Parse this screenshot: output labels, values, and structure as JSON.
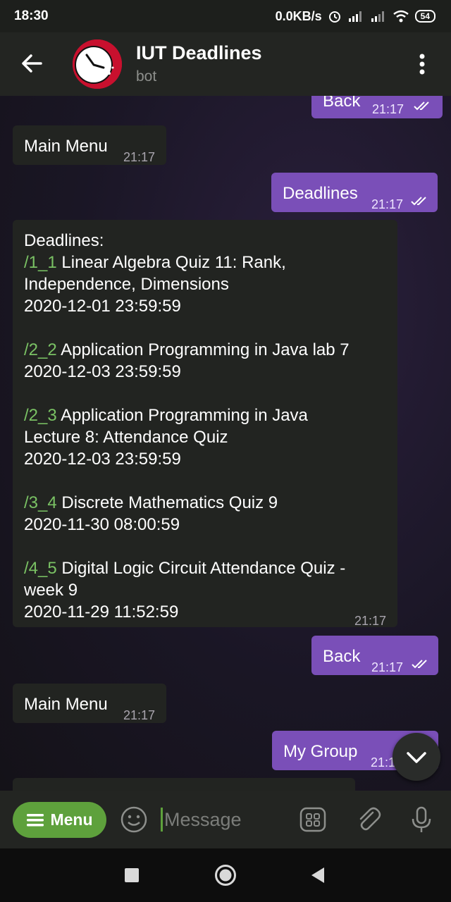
{
  "status_bar": {
    "time": "18:30",
    "net_speed": "0.0KB/s",
    "battery": "54",
    "icons": [
      "alarm-icon",
      "signal-icon",
      "signal-icon",
      "wifi-icon",
      "battery-icon"
    ]
  },
  "header": {
    "title": "IUT Deadlines",
    "subtitle": "bot"
  },
  "messages": {
    "m0": {
      "text": "Back",
      "time": "21:17"
    },
    "m1": {
      "text": "Main Menu",
      "time": "21:17"
    },
    "m2": {
      "text": "Deadlines",
      "time": "21:17"
    },
    "m3": {
      "heading": "Deadlines:",
      "items": [
        {
          "cmd": "/1_1",
          "line1": " Linear Algebra Quiz 11: Rank,",
          "line2": "Independence, Dimensions",
          "date": "2020-12-01 23:59:59"
        },
        {
          "cmd": "/2_2",
          "line1": " Application Programming in Java lab 7",
          "line2": "",
          "date": "2020-12-03 23:59:59"
        },
        {
          "cmd": "/2_3",
          "line1": " Application Programming in Java",
          "line2": "Lecture 8: Attendance Quiz",
          "date": "2020-12-03 23:59:59"
        },
        {
          "cmd": "/3_4",
          "line1": " Discrete Mathematics Quiz 9",
          "line2": "",
          "date": "2020-11-30 08:00:59"
        },
        {
          "cmd": "/4_5",
          "line1": " Digital Logic Circuit Attendance Quiz -",
          "line2": "week 9",
          "date": "2020-11-29 11:52:59"
        }
      ],
      "time": "21:17"
    },
    "m4": {
      "text": "Back",
      "time": "21:17"
    },
    "m5": {
      "text": "Main Menu",
      "time": "21:17"
    },
    "m6": {
      "text": "My Group",
      "time": "21:17"
    }
  },
  "input": {
    "menu_label": "Menu",
    "placeholder": "Message"
  },
  "colors": {
    "accent_green": "#5ea13c",
    "outgoing_bubble": "#7a4fb8",
    "incoming_bubble": "#222421",
    "command_link": "#7ac264"
  }
}
